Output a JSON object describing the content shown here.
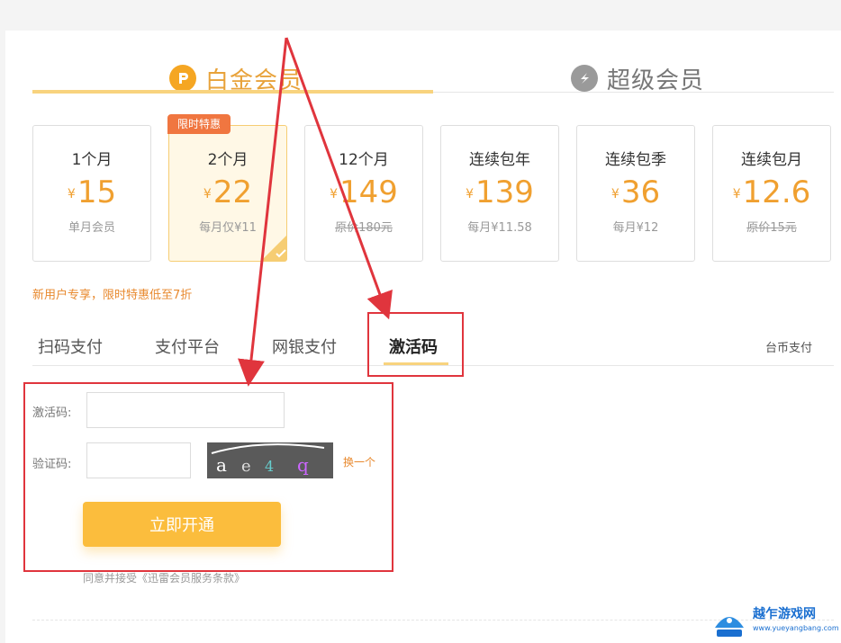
{
  "tiers": [
    {
      "label": "白金会员",
      "active": true
    },
    {
      "label": "超级会员",
      "active": false
    }
  ],
  "promo_badge": "限时特惠",
  "plans": [
    {
      "name": "1个月",
      "currency": "¥",
      "price": "15",
      "sub": "单月会员",
      "strike": false
    },
    {
      "name": "2个月",
      "currency": "¥",
      "price": "22",
      "sub": "每月仅¥11",
      "strike": false,
      "selected": true
    },
    {
      "name": "12个月",
      "currency": "¥",
      "price": "149",
      "sub": "原价180元",
      "strike": true
    },
    {
      "name": "连续包年",
      "currency": "¥",
      "price": "139",
      "sub": "每月¥11.58",
      "strike": false
    },
    {
      "name": "连续包季",
      "currency": "¥",
      "price": "36",
      "sub": "每月¥12",
      "strike": false
    },
    {
      "name": "连续包月",
      "currency": "¥",
      "price": "12.6",
      "sub": "原价15元",
      "strike": true
    }
  ],
  "promo_note": "新用户专享，限时特惠低至7折",
  "pay_tabs": [
    "扫码支付",
    "支付平台",
    "网银支付",
    "激活码"
  ],
  "coin_pay": "台币支付",
  "form": {
    "code_label": "激活码:",
    "captcha_label": "验证码:",
    "refresh": "换一个",
    "submit": "立即开通",
    "terms": "同意并接受《迅雷会员服务条款》"
  },
  "watermark": {
    "name": "越乍游戏网",
    "url": "www.yueyangbang.com"
  },
  "colors": {
    "accent": "#f0a030",
    "highlight": "#e0353d",
    "button": "#fbbd3d",
    "promo": "#f07640"
  }
}
